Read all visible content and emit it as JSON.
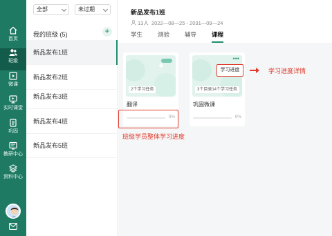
{
  "nav": {
    "items": [
      {
        "label": "首页",
        "icon": "home-icon"
      },
      {
        "label": "班级",
        "icon": "users-icon"
      },
      {
        "label": "微课",
        "icon": "play-square-icon"
      },
      {
        "label": "实时课堂",
        "icon": "live-screen-icon"
      },
      {
        "label": "巩固",
        "icon": "document-icon"
      },
      {
        "label": "教研中心",
        "icon": "research-icon"
      },
      {
        "label": "资料中心",
        "icon": "layers-icon"
      }
    ],
    "active_item": "班级"
  },
  "filters": {
    "subject": "全部",
    "status": "未过期"
  },
  "class_list": {
    "heading": "我的班级 (5)",
    "add_symbol": "+",
    "items": [
      "新品发布1班",
      "新品发布2班",
      "新品发布3班",
      "新品发布4班",
      "新品发布5班"
    ]
  },
  "class_detail": {
    "title": "新品发布1班",
    "students": "13人",
    "date_range": "2022—08—25 - 2031—09—24",
    "tabs": [
      "学生",
      "测验",
      "辅导",
      "课程"
    ],
    "active_tab": "课程"
  },
  "courses": [
    {
      "name": "翻译",
      "tag": "2个学习任务",
      "progress_text": "0%",
      "progress": 0
    },
    {
      "name": "巩固微课",
      "tag": "3个目录14个学习任务",
      "progress_text": "0%",
      "progress": 0,
      "more": "•••"
    }
  ],
  "popup": {
    "label": "学习进度"
  },
  "annotations": {
    "progress_detail": "学习进度详情",
    "overall_progress": "班级学员整体学习进度"
  },
  "colors": {
    "nav_bg": "#1f7a64",
    "accent": "#1f8a6c",
    "annotation": "#e03a2a",
    "card_banner": "#e2f3ee"
  }
}
